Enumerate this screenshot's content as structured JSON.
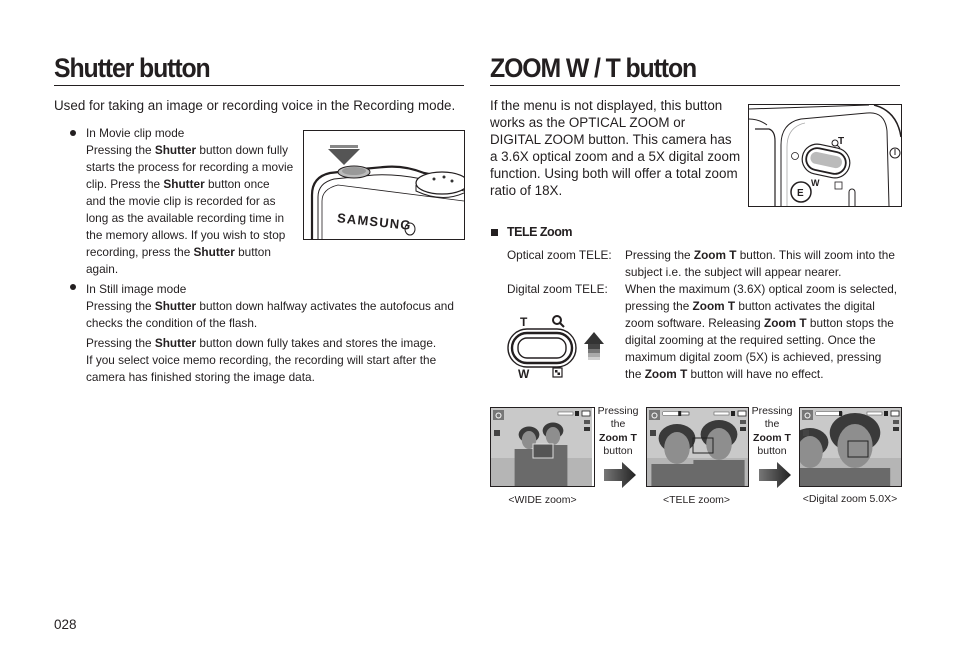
{
  "left": {
    "title": "Shutter button",
    "intro": "Used for taking an image or recording voice in the Recording mode.",
    "movie": {
      "heading": "In Movie clip mode",
      "lines": [
        [
          "Pressing the ",
          "Shutter",
          " button down fully"
        ],
        [
          "starts the process for recording a movie"
        ],
        [
          "clip. Press the ",
          "Shutter",
          " button once"
        ],
        [
          "and the movie clip is recorded for as"
        ],
        [
          "long as the available recording time in"
        ],
        [
          "the memory allows. If you wish to stop"
        ],
        [
          "recording, press the ",
          "Shutter",
          " button"
        ],
        [
          "again."
        ]
      ]
    },
    "still": {
      "heading": "In Still image mode",
      "p1_lines": [
        [
          "Pressing the ",
          "Shutter",
          " button down halfway activates the autofocus and"
        ],
        [
          "checks the condition of the flash."
        ]
      ],
      "p2_lines": [
        [
          "Pressing the ",
          "Shutter",
          " button down fully takes and stores the image."
        ],
        [
          "If you select voice memo recording, the recording will start after the"
        ],
        [
          "camera has finished storing the image data."
        ]
      ]
    },
    "camera_illustration": {
      "brand": "SAMSUNG"
    }
  },
  "right": {
    "title": "ZOOM W / T button",
    "intro_lines": [
      "If the menu is not displayed, this button",
      "works as the OPTICAL ZOOM or",
      "DIGITAL ZOOM button. This camera has",
      "a 3.6X optical zoom and a 5X digital zoom",
      "function. Using both will offer a total zoom",
      "ratio of 18X."
    ],
    "camera_labels": {
      "t": "T",
      "w": "W",
      "e": "E"
    },
    "tele": {
      "heading": "TELE Zoom",
      "optical_label": "Optical zoom TELE:",
      "optical_lines": [
        [
          "Pressing the ",
          "Zoom T",
          " button. This will zoom into the"
        ],
        [
          "subject i.e. the subject will appear nearer."
        ]
      ],
      "digital_label": "Digital zoom TELE:",
      "digital_lines": [
        [
          "When the maximum (3.6X) optical zoom is selected,"
        ],
        [
          "pressing the ",
          "Zoom T",
          " button activates the digital"
        ],
        [
          "zoom software. Releasing ",
          "Zoom T",
          " button stops the"
        ],
        [
          "digital zooming at the required setting. Once the"
        ],
        [
          "maximum digital zoom (5X) is achieved, pressing"
        ],
        [
          "the ",
          "Zoom T",
          " button will have no effect."
        ]
      ],
      "button_labels": {
        "t": "T",
        "w": "W"
      }
    },
    "sequence": {
      "press_line1": "Pressing",
      "press_line2": "the",
      "press_line3": "Zoom T",
      "press_line4": "button",
      "captions": [
        "<WIDE zoom>",
        "<TELE zoom>",
        "<Digital zoom 5.0X>"
      ],
      "zoom_bar_levels": [
        0,
        0.7,
        1.0
      ]
    }
  },
  "page_number": "028"
}
